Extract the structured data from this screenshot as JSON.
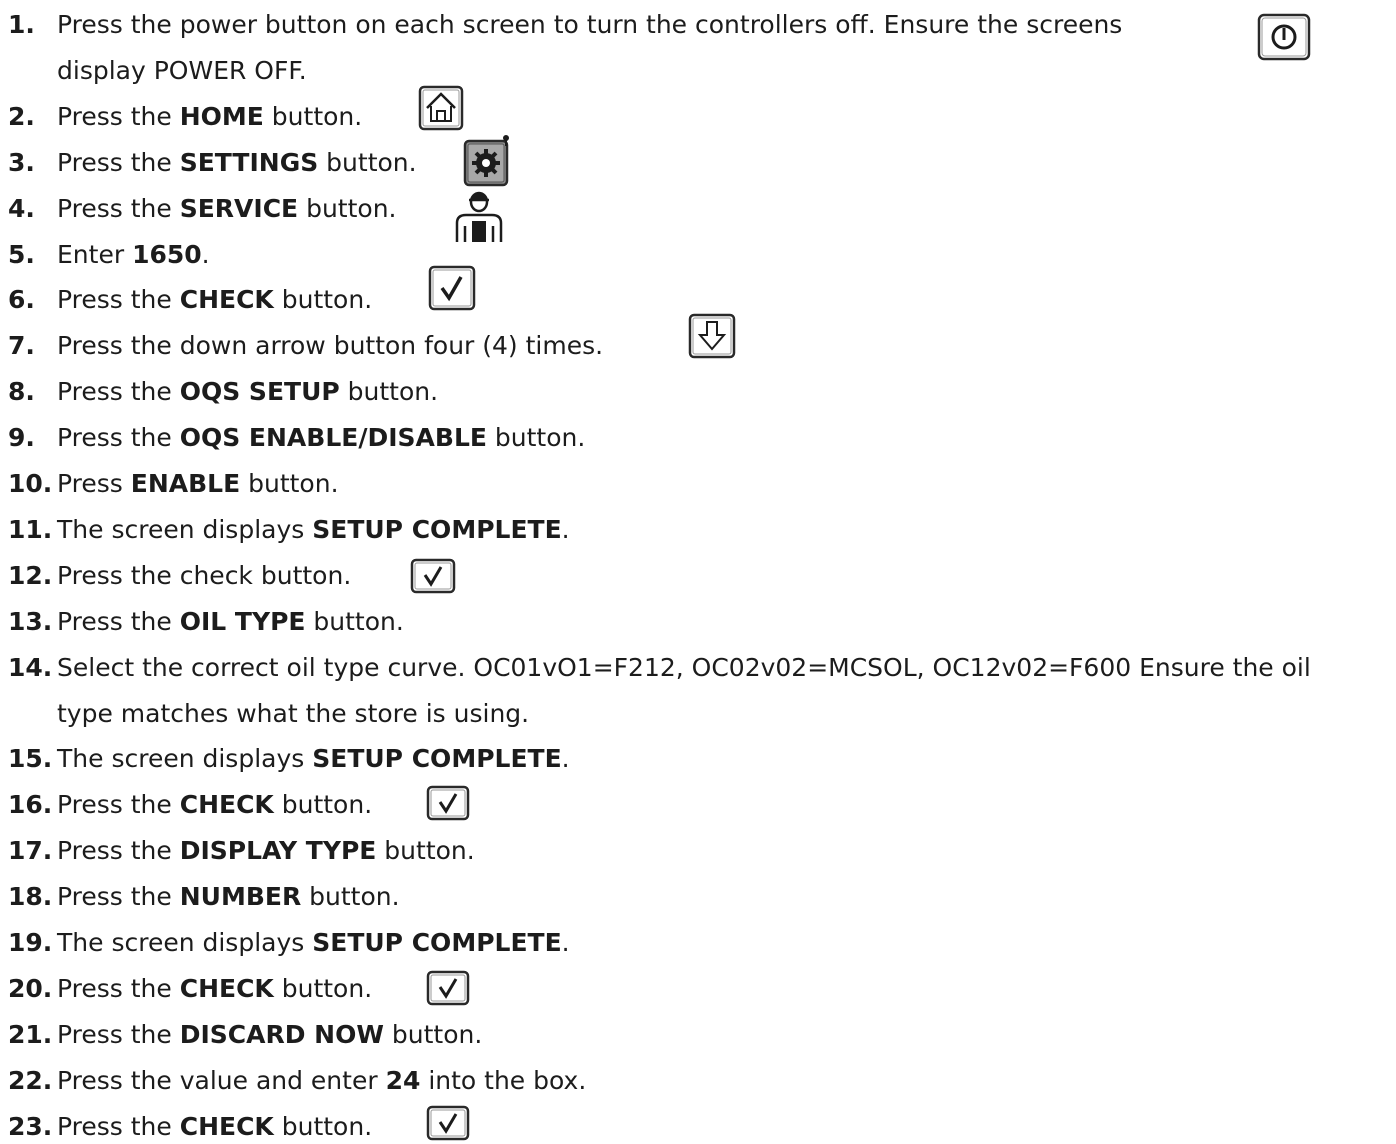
{
  "steps": [
    {
      "num": "1.",
      "parts": [
        {
          "t": "Press the power button on each screen to turn the controllers off. Ensure the screens",
          "b": false
        }
      ],
      "cont": "display POWER OFF."
    },
    {
      "num": "2.",
      "parts": [
        {
          "t": "Press the ",
          "b": false
        },
        {
          "t": "HOME",
          "b": true
        },
        {
          "t": " button.",
          "b": false
        }
      ]
    },
    {
      "num": "3.",
      "parts": [
        {
          "t": "Press the ",
          "b": false
        },
        {
          "t": "SETTINGS",
          "b": true
        },
        {
          "t": " button.",
          "b": false
        }
      ]
    },
    {
      "num": "4.",
      "parts": [
        {
          "t": "Press the ",
          "b": false
        },
        {
          "t": "SERVICE",
          "b": true
        },
        {
          "t": " button.",
          "b": false
        }
      ]
    },
    {
      "num": "5.",
      "parts": [
        {
          "t": "Enter ",
          "b": false
        },
        {
          "t": "1650",
          "b": true
        },
        {
          "t": ".",
          "b": false
        }
      ]
    },
    {
      "num": "6.",
      "parts": [
        {
          "t": "Press the ",
          "b": false
        },
        {
          "t": "CHECK",
          "b": true
        },
        {
          "t": " button.",
          "b": false
        }
      ]
    },
    {
      "num": "7.",
      "parts": [
        {
          "t": "Press the down arrow button four (4) times.",
          "b": false
        }
      ]
    },
    {
      "num": "8.",
      "parts": [
        {
          "t": "Press the ",
          "b": false
        },
        {
          "t": "OQS SETUP",
          "b": true
        },
        {
          "t": " button.",
          "b": false
        }
      ]
    },
    {
      "num": "9.",
      "parts": [
        {
          "t": "Press the ",
          "b": false
        },
        {
          "t": "OQS ENABLE/DISABLE",
          "b": true
        },
        {
          "t": " button.",
          "b": false
        }
      ]
    },
    {
      "num": "10.",
      "parts": [
        {
          "t": "Press ",
          "b": false
        },
        {
          "t": "ENABLE",
          "b": true
        },
        {
          "t": " button.",
          "b": false
        }
      ]
    },
    {
      "num": "11.",
      "parts": [
        {
          "t": "The screen displays ",
          "b": false
        },
        {
          "t": "SETUP COMPLETE",
          "b": true
        },
        {
          "t": ".",
          "b": false
        }
      ]
    },
    {
      "num": "12.",
      "parts": [
        {
          "t": "Press the check button.",
          "b": false
        }
      ]
    },
    {
      "num": "13.",
      "parts": [
        {
          "t": "Press the ",
          "b": false
        },
        {
          "t": "OIL TYPE",
          "b": true
        },
        {
          "t": " button.",
          "b": false
        }
      ]
    },
    {
      "num": "14.",
      "parts": [
        {
          "t": "Select the correct oil type curve. OC01vO1=F212, OC02v02=MCSOL, OC12v02=F600 Ensure the oil",
          "b": false
        }
      ],
      "cont": "type matches what the store is using."
    },
    {
      "num": "15.",
      "parts": [
        {
          "t": "The screen displays ",
          "b": false
        },
        {
          "t": "SETUP COMPLETE",
          "b": true
        },
        {
          "t": ".",
          "b": false
        }
      ]
    },
    {
      "num": "16.",
      "parts": [
        {
          "t": "Press the ",
          "b": false
        },
        {
          "t": "CHECK",
          "b": true
        },
        {
          "t": " button.",
          "b": false
        }
      ]
    },
    {
      "num": "17.",
      "parts": [
        {
          "t": "Press the ",
          "b": false
        },
        {
          "t": "DISPLAY TYPE",
          "b": true
        },
        {
          "t": " button.",
          "b": false
        }
      ]
    },
    {
      "num": "18.",
      "parts": [
        {
          "t": "Press the ",
          "b": false
        },
        {
          "t": "NUMBER",
          "b": true
        },
        {
          "t": " button.",
          "b": false
        }
      ]
    },
    {
      "num": "19.",
      "parts": [
        {
          "t": "The screen displays ",
          "b": false
        },
        {
          "t": "SETUP COMPLETE",
          "b": true
        },
        {
          "t": ".",
          "b": false
        }
      ]
    },
    {
      "num": "20.",
      "parts": [
        {
          "t": "Press the ",
          "b": false
        },
        {
          "t": "CHECK",
          "b": true
        },
        {
          "t": " button.",
          "b": false
        }
      ]
    },
    {
      "num": "21.",
      "parts": [
        {
          "t": "Press the ",
          "b": false
        },
        {
          "t": "DISCARD NOW",
          "b": true
        },
        {
          "t": " button.",
          "b": false
        }
      ]
    },
    {
      "num": "22.",
      "parts": [
        {
          "t": "Press the value and enter ",
          "b": false
        },
        {
          "t": "24",
          "b": true
        },
        {
          "t": " into the box.",
          "b": false
        }
      ]
    },
    {
      "num": "23.",
      "parts": [
        {
          "t": "Press the ",
          "b": false
        },
        {
          "t": "CHECK",
          "b": true
        },
        {
          "t": " button.",
          "b": false
        }
      ]
    }
  ],
  "icons": {
    "power": "power-icon",
    "home": "home-icon",
    "settings": "settings-gear-icon",
    "service": "service-technician-icon",
    "check": "check-icon",
    "down_arrow": "down-arrow-icon"
  },
  "colors": {
    "text": "#1c1c1c",
    "icon_stroke": "#2a2a2a",
    "settings_fill": "#8c8c8c"
  }
}
